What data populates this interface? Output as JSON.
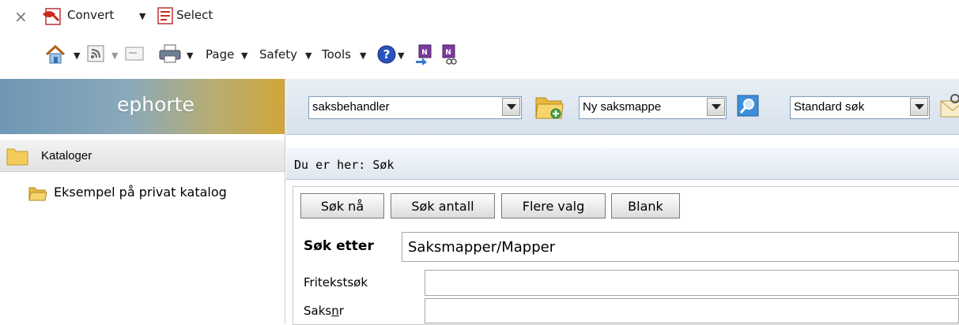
{
  "ie_toolbar": {
    "close_glyph": "×",
    "convert_label": "Convert",
    "select_label": "Select",
    "page_label": "Page",
    "safety_label": "Safety",
    "tools_label": "Tools"
  },
  "sidebar": {
    "brand": "ephorte",
    "catalogs_label": "Kataloger",
    "items": [
      {
        "label": "Eksempel på privat katalog"
      }
    ]
  },
  "topbar": {
    "role_select": "saksbehandler",
    "new_select": "Ny saksmappe",
    "search_select": "Standard søk"
  },
  "breadcrumb": "Du er her: Søk",
  "buttons": {
    "search_now": "Søk nå",
    "search_count": "Søk antall",
    "more_options": "Flere valg",
    "blank": "Blank"
  },
  "search_for": {
    "label": "Søk etter",
    "value": "Saksmapper/Mapper"
  },
  "fields": [
    {
      "label": "Fritekstsøk",
      "value": ""
    },
    {
      "label_pre": "Saks",
      "label_underlined": "n",
      "label_post": "r",
      "value": ""
    }
  ],
  "colors": {
    "brand_gradient_start": "#6f97b4",
    "brand_gradient_end": "#d1a63a",
    "pdf_red": "#cc2a1f",
    "help_blue": "#2a52be"
  }
}
